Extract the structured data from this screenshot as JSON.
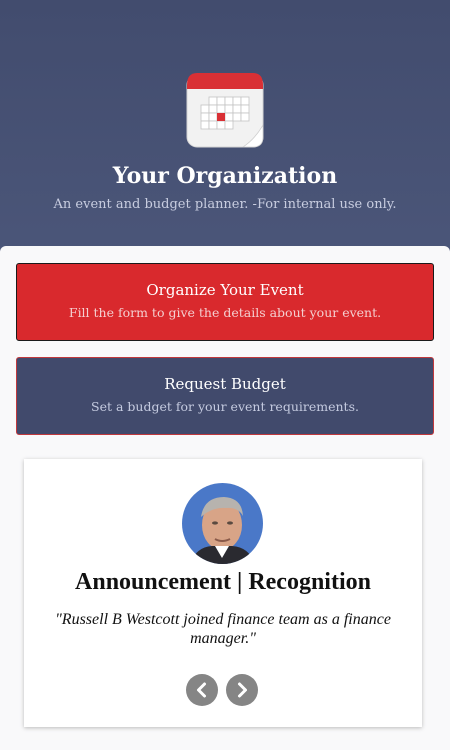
{
  "header": {
    "title": "Your Organization",
    "subtitle": "An event and budget planner. -For internal use only.",
    "icon": "calendar-icon"
  },
  "actions": [
    {
      "title": "Organize Your Event",
      "subtitle": "Fill the form to give the details about your event.",
      "color": "#d9292d"
    },
    {
      "title": "Request Budget",
      "subtitle": "Set a budget for your event requirements.",
      "color": "#414a6c"
    }
  ],
  "announcement": {
    "title": "Announcement | Recognition",
    "quote": "\"Russell B Westcott joined finance team as a finance manager.\"",
    "prev_icon": "chevron-left-icon",
    "next_icon": "chevron-right-icon"
  },
  "colors": {
    "header_bg": "#434d6f",
    "accent_red": "#d9292d",
    "accent_navy": "#414a6c"
  }
}
